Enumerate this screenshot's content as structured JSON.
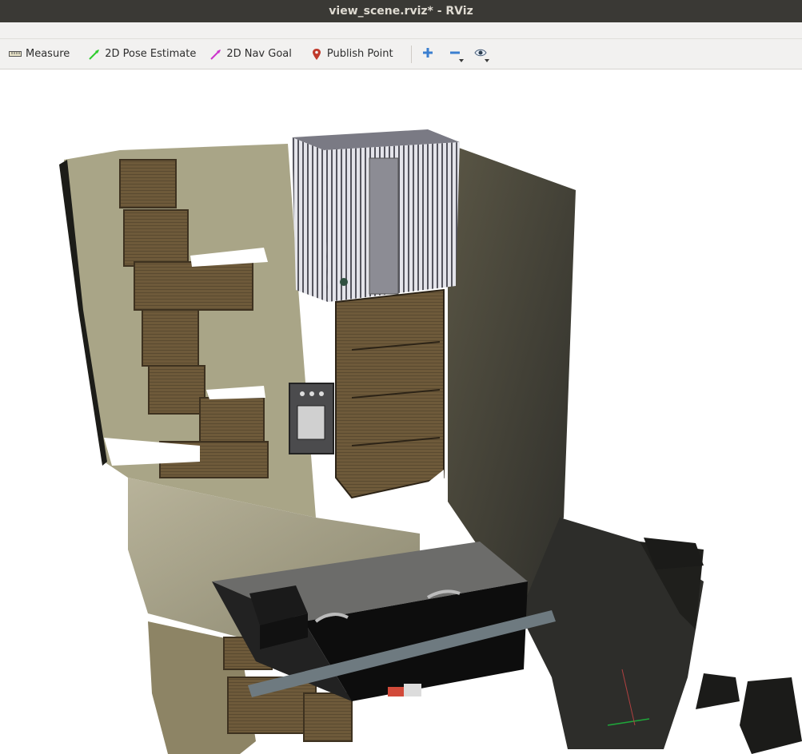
{
  "window": {
    "title": "view_scene.rviz* - RViz"
  },
  "toolbar": {
    "tools": [
      {
        "label": "Measure",
        "icon": "ruler-icon"
      },
      {
        "label": "2D Pose Estimate",
        "icon": "green-arrow-icon"
      },
      {
        "label": "2D Nav Goal",
        "icon": "magenta-arrow-icon"
      },
      {
        "label": "Publish Point",
        "icon": "map-pin-icon"
      }
    ],
    "extras": [
      {
        "icon": "plus-icon"
      },
      {
        "icon": "minus-icon"
      },
      {
        "icon": "eye-icon"
      }
    ]
  },
  "colors": {
    "titlebar": "#3a3935",
    "toolbar": "#f2f1f0",
    "background": "#ffffff",
    "pose_arrow": "#2ecc2e",
    "goal_arrow": "#cc33cc",
    "pin": "#c0392b",
    "plus": "#3b7fd0"
  }
}
